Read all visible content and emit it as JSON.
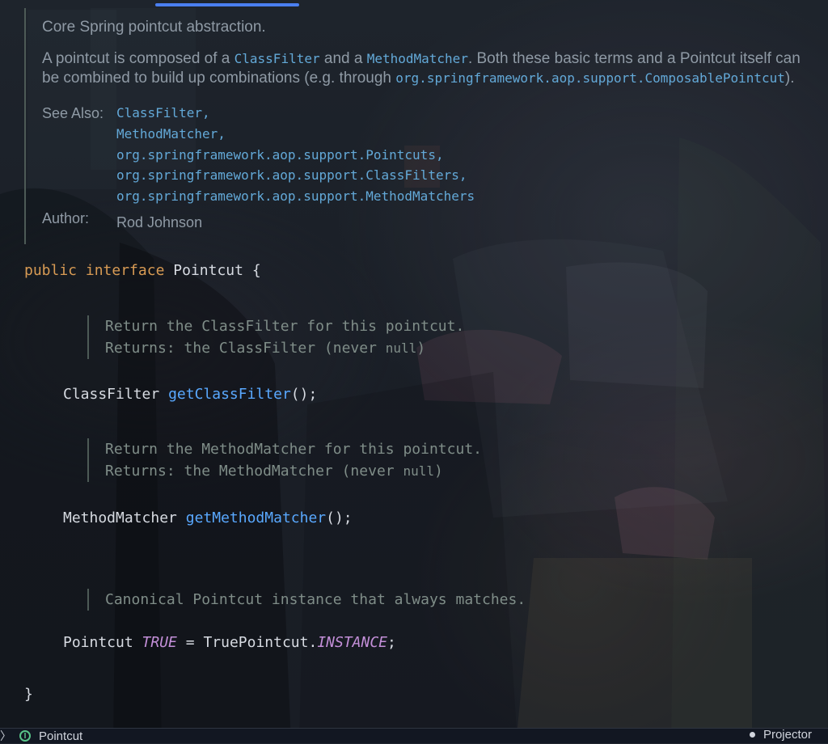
{
  "doc": {
    "title": "Core Spring pointcut abstraction.",
    "description_prefix": "A pointcut is composed of a ",
    "description_class_filter": "ClassFilter",
    "description_and": " and a ",
    "description_method_matcher": "MethodMatcher",
    "description_middle": ". Both these basic terms and a Pointcut itself can be combined to build up combinations (e.g. through ",
    "description_link": "org.springframework.aop.support.ComposablePointcut",
    "description_suffix": ").",
    "see_also_label": "See Also:",
    "see_also": [
      "ClassFilter,",
      "MethodMatcher,",
      "org.springframework.aop.support.Pointcuts,",
      "org.springframework.aop.support.ClassFilters,",
      "org.springframework.aop.support.MethodMatchers"
    ],
    "author_label": "Author:",
    "author_value": "Rod Johnson"
  },
  "code": {
    "public_kw": "public",
    "interface_kw": "interface",
    "interface_name": "Pointcut",
    "open_brace": "{",
    "class_filter_type": "ClassFilter",
    "class_filter_method": "getClassFilter",
    "class_filter_suffix": "();",
    "method_matcher_type": "MethodMatcher",
    "method_matcher_method": "getMethodMatcher",
    "method_matcher_suffix": "();",
    "pointcut_type": "Pointcut",
    "true_constant": "TRUE",
    "equals": "=",
    "true_pointcut_class": "TruePointcut.",
    "instance_constant": "INSTANCE",
    "statement_end": ";",
    "close_brace": "}"
  },
  "method_docs": {
    "class_filter_line1": "Return the ClassFilter for this pointcut.",
    "class_filter_returns_prefix": "Returns: the ClassFilter (never ",
    "class_filter_null": "null",
    "class_filter_returns_suffix": ")",
    "method_matcher_line1": "Return the MethodMatcher for this pointcut.",
    "method_matcher_returns_prefix": "Returns: the MethodMatcher (never ",
    "method_matcher_null": "null",
    "method_matcher_returns_suffix": ")",
    "true_line1": "Canonical Pointcut instance that always matches."
  },
  "statusbar": {
    "chevron": "〉",
    "interface_badge": "I",
    "left_label": "Pointcut",
    "right_label": "Projector"
  },
  "colors": {
    "accent": "#4a7ff0",
    "keyword": "#d89b54",
    "function": "#59a8ff",
    "constant": "#c38fd8",
    "doc_link": "#63a9d8"
  }
}
